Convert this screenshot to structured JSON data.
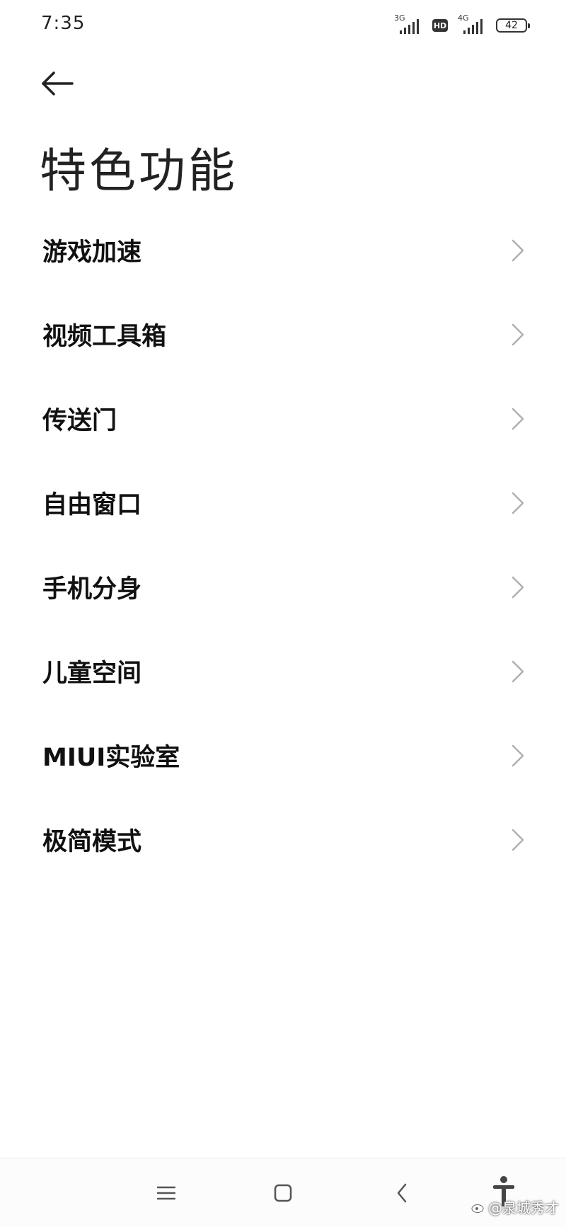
{
  "status_bar": {
    "time": "7:35",
    "signal1_network": "3G",
    "hd_badge": "HD",
    "signal2_network": "4G",
    "battery_level": "42"
  },
  "header": {
    "title": "特色功能"
  },
  "features": [
    {
      "label": "游戏加速"
    },
    {
      "label": "视频工具箱"
    },
    {
      "label": "传送门"
    },
    {
      "label": "自由窗口"
    },
    {
      "label": "手机分身"
    },
    {
      "label": "儿童空间"
    },
    {
      "label": "MIUI实验室"
    },
    {
      "label": "极简模式"
    }
  ],
  "watermark": {
    "text": "@泉城秀才"
  },
  "icons": {
    "back": "arrow-left-icon",
    "chevron": "chevron-right-icon",
    "nav_menu": "menu-icon",
    "nav_home": "home-square-icon",
    "nav_back": "back-chevron-icon",
    "accessibility": "accessibility-icon"
  },
  "colors": {
    "background": "#ffffff",
    "text_primary": "#111111",
    "chevron": "#b0b0b0"
  }
}
